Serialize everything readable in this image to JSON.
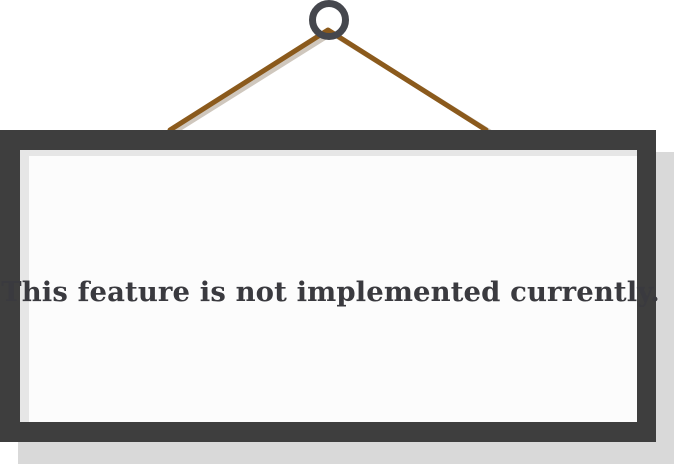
{
  "sign": {
    "message": "This feature is not implemented currently."
  },
  "colors": {
    "frame": "#3e3e3e",
    "panel": "#fcfcfc",
    "shadow": "#d9d9d9",
    "rope": "#8b5a1c",
    "nail": "#45474d",
    "text": "#3a3a3f"
  },
  "icons": {
    "nail": "nail-icon",
    "rope": "rope-icon"
  }
}
